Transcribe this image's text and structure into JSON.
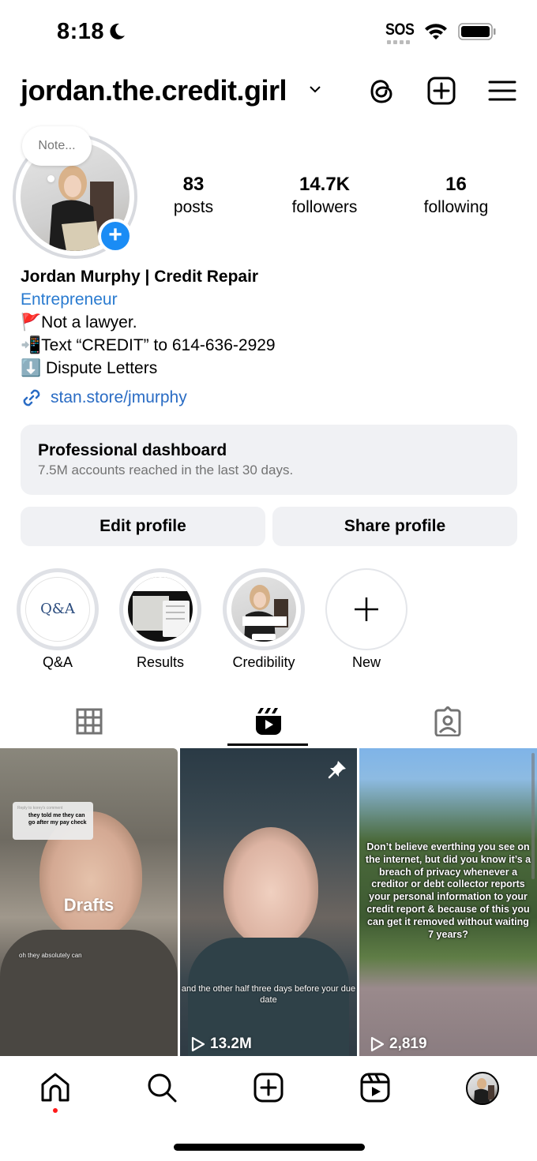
{
  "status_bar": {
    "time": "8:18",
    "carrier": "SOS"
  },
  "header": {
    "username": "jordan.the.credit.girl"
  },
  "profile": {
    "note_placeholder": "Note...",
    "stats": [
      {
        "value": "83",
        "label": "posts"
      },
      {
        "value": "14.7K",
        "label": "followers"
      },
      {
        "value": "16",
        "label": "following"
      }
    ],
    "name": "Jordan Murphy | Credit Repair",
    "category": "Entrepreneur",
    "bio_lines": [
      "🚩Not a lawyer.",
      "📲Text “CREDIT” to 614-636-2929",
      "⬇️ Dispute Letters"
    ],
    "link": "stan.store/jmurphy"
  },
  "dashboard": {
    "title": "Professional dashboard",
    "subtitle": "7.5M accounts reached in the last 30 days."
  },
  "buttons": {
    "edit": "Edit profile",
    "share": "Share profile"
  },
  "highlights": [
    {
      "label": "Q&A",
      "cover_text": "Q&A"
    },
    {
      "label": "Results"
    },
    {
      "label": "Credibility"
    },
    {
      "label": "New"
    }
  ],
  "tabs": [
    {
      "name": "grid",
      "icon": "grid-icon"
    },
    {
      "name": "reels",
      "icon": "reels-icon",
      "active": true
    },
    {
      "name": "tagged",
      "icon": "tagged-icon"
    }
  ],
  "grid": [
    {
      "overlay_label": "Drafts",
      "reply_meta": "Reply to korey's comment",
      "reply_text": "they told me they can go after my pay check",
      "caption": "oh they absolutely can"
    },
    {
      "pinned": true,
      "caption": "and the other half three days before your due date",
      "views": "13.2M"
    },
    {
      "caption": "Don’t believe everthing you see on the internet, but did you know it’s a breach of privacy whenever a creditor or debt collector reports your personal information to your credit report & because of this you can get it removed without waiting 7 years?",
      "views": "2,819"
    }
  ],
  "bottom_nav": [
    "home",
    "search",
    "create",
    "reels",
    "profile"
  ],
  "colors": {
    "accent_blue": "#1a8cf5",
    "link_blue": "#2a6cc4",
    "button_bg": "#f0f1f4",
    "notification_red": "#ff1a1a"
  }
}
